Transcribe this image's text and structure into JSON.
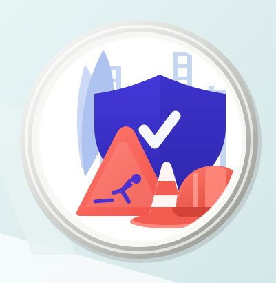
{
  "icon": {
    "name": "construction-safety-badge",
    "colors": {
      "background": "#dfeeee",
      "frame_light": "#f3f3f1",
      "frame_mid": "#cfcfcb",
      "frame_dark": "#9c9c97",
      "disc": "#ffffff",
      "skyline": "#b9cdf3",
      "shield": "#3d34cf",
      "shield_dark": "#2c24a7",
      "check": "#f5f7ff",
      "warning_orange": "#f45b4f",
      "warning_light": "#ff786d",
      "cone_white": "#fff5f2",
      "helmet": "#ef5447"
    }
  }
}
